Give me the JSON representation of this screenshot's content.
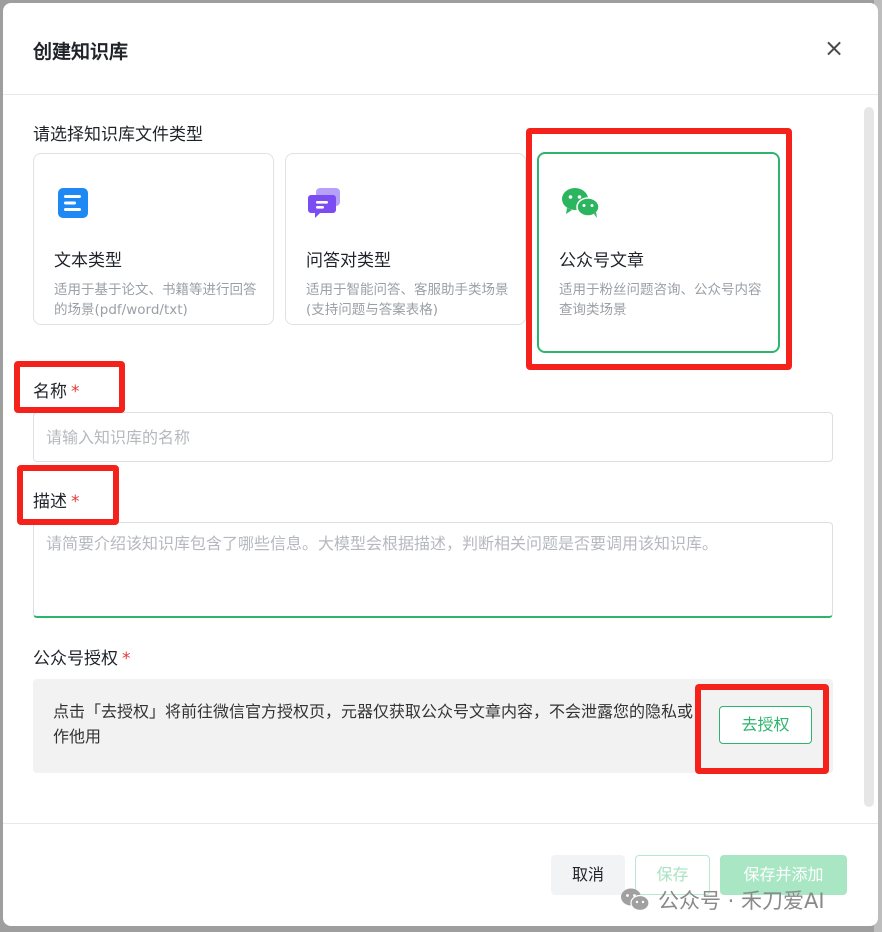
{
  "dialog": {
    "title": "创建知识库",
    "close_symbol": "×"
  },
  "type_section": {
    "label": "请选择知识库文件类型",
    "cards": [
      {
        "title": "文本类型",
        "desc": "适用于基于论文、书籍等进行回答的场景(pdf/word/txt)",
        "icon": "document-icon",
        "selected": false
      },
      {
        "title": "问答对类型",
        "desc": "适用于智能问答、客服助手类场景(支持问题与答案表格)",
        "icon": "chat-bubbles-icon",
        "selected": false
      },
      {
        "title": "公众号文章",
        "desc": "适用于粉丝问题咨询、公众号内容查询类场景",
        "icon": "wechat-icon",
        "selected": true
      }
    ]
  },
  "name_field": {
    "label": "名称",
    "required_mark": "*",
    "placeholder": "请输入知识库的名称",
    "value": ""
  },
  "desc_field": {
    "label": "描述",
    "required_mark": "*",
    "placeholder": "请简要介绍该知识库包含了哪些信息。大模型会根据描述，判断相关问题是否要调用该知识库。",
    "value": ""
  },
  "auth_section": {
    "label": "公众号授权",
    "required_mark": "*",
    "text": "点击「去授权」将前往微信官方授权页，元器仅获取公众号文章内容，不会泄露您的隐私或作他用",
    "button": "去授权"
  },
  "footer": {
    "cancel": "取消",
    "save": "保存",
    "save_add": "保存并添加"
  },
  "watermark": {
    "text": "公众号 · 禾刀爱AI"
  },
  "colors": {
    "accent": "#2fb46e",
    "highlight": "#f5221b",
    "required": "#e53935"
  }
}
